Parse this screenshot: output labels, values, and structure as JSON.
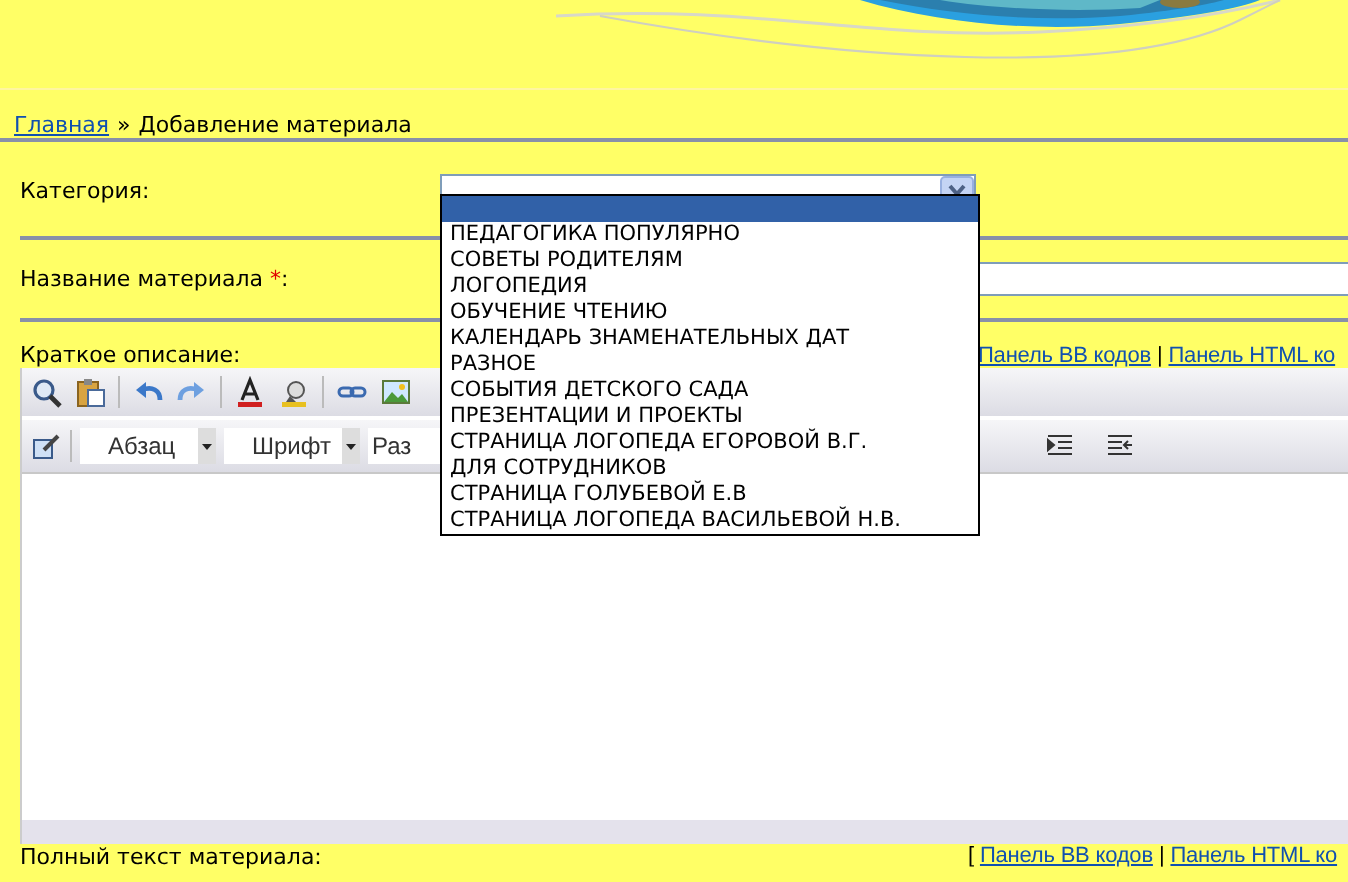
{
  "breadcrumb": {
    "home_link": "Главная",
    "separator": "»",
    "current": "Добавление материала"
  },
  "category": {
    "label": "Категория:",
    "options": [
      {
        "selected": true
      },
      {
        "label": "ПЕДАГОГИКА ПОПУЛЯРНО",
        "selected": false
      },
      {
        "label": "СОВЕТЫ РОДИТЕЛЯМ",
        "selected": false
      },
      {
        "label": "ЛОГОПЕДИЯ",
        "selected": false
      },
      {
        "label": "ОБУЧЕНИЕ ЧТЕНИЮ",
        "selected": false
      },
      {
        "label": "КАЛЕНДАРЬ ЗНАМЕНАТЕЛЬНЫХ ДАТ",
        "selected": false
      },
      {
        "label": "РАЗНОЕ",
        "selected": false
      },
      {
        "label": "СОБЫТИЯ ДЕТСКОГО САДА",
        "selected": false
      },
      {
        "label": "ПРЕЗЕНТАЦИИ И ПРОЕКТЫ",
        "selected": false
      },
      {
        "label": "СТРАНИЦА ЛОГОПЕДА ЕГОРОВОЙ В.Г.",
        "selected": false
      },
      {
        "label": "ДЛЯ СОТРУДНИКОВ",
        "selected": false
      },
      {
        "label": "СТРАНИЦА ГОЛУБЕВОЙ Е.В",
        "selected": false
      },
      {
        "label": "СТРАНИЦА ЛОГОПЕДА ВАСИЛЬЕВОЙ Н.В.",
        "selected": false
      }
    ]
  },
  "title_field": {
    "label": "Название материала ",
    "required_mark": "*",
    "colon": ":"
  },
  "short_description": {
    "label": "Краткое описание:",
    "links": [
      "Панель BB кодов",
      "Панель HTML ко"
    ],
    "link_separator": "|",
    "format_dropdowns": [
      "Абзац",
      "Шрифт",
      "Раз"
    ]
  },
  "full_text": {
    "label": "Полный текст материала:",
    "open_bracket": "[",
    "links": [
      "Панель BB кодов",
      "Панель HTML ко"
    ],
    "link_separator": "|"
  }
}
